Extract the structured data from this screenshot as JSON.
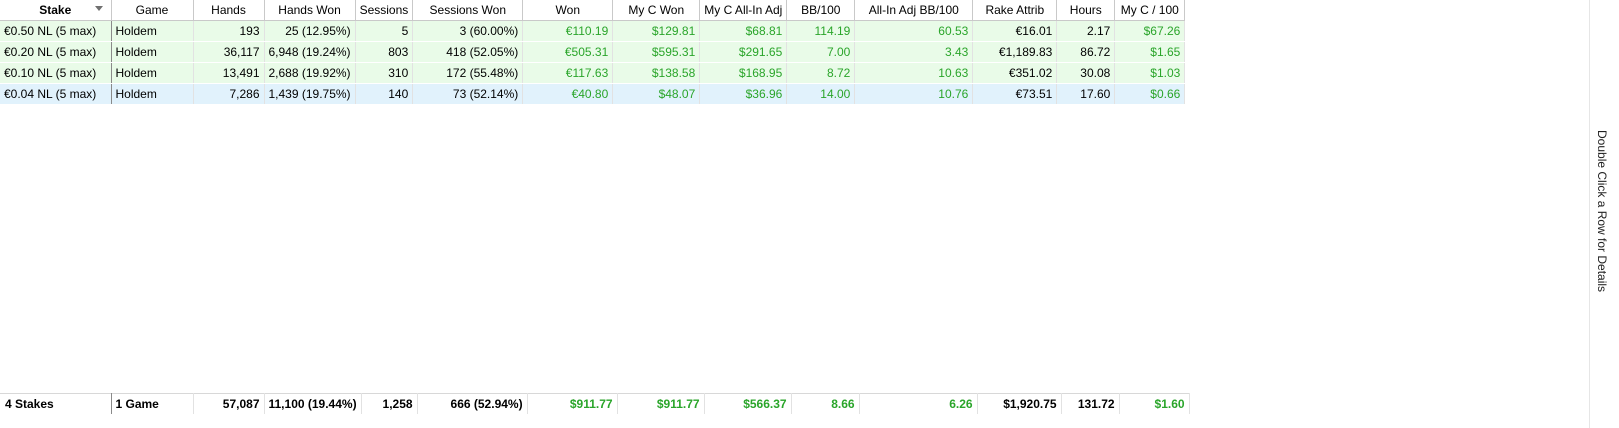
{
  "columns": [
    "Stake",
    "Game",
    "Hands",
    "Hands Won",
    "Sessions",
    "Sessions Won",
    "Won",
    "My C Won",
    "My C All-In Adj",
    "BB/100",
    "All-In Adj BB/100",
    "Rake Attrib",
    "Hours",
    "My C / 100"
  ],
  "rows": [
    {
      "stake": "€0.50 NL (5 max)",
      "game": "Holdem",
      "hands": "193",
      "hands_won": "25 (12.95%)",
      "sessions": "5",
      "sessions_won": "3 (60.00%)",
      "won": "€110.19",
      "my_c_won": "$129.81",
      "my_c_allin_adj": "$68.81",
      "bb100": "114.19",
      "allin_adj_bb100": "60.53",
      "rake_attrib": "€16.01",
      "hours": "2.17",
      "my_c_100": "$67.26",
      "highlight": "green"
    },
    {
      "stake": "€0.20 NL (5 max)",
      "game": "Holdem",
      "hands": "36,117",
      "hands_won": "6,948 (19.24%)",
      "sessions": "803",
      "sessions_won": "418 (52.05%)",
      "won": "€505.31",
      "my_c_won": "$595.31",
      "my_c_allin_adj": "$291.65",
      "bb100": "7.00",
      "allin_adj_bb100": "3.43",
      "rake_attrib": "€1,189.83",
      "hours": "86.72",
      "my_c_100": "$1.65",
      "highlight": "green"
    },
    {
      "stake": "€0.10 NL (5 max)",
      "game": "Holdem",
      "hands": "13,491",
      "hands_won": "2,688 (19.92%)",
      "sessions": "310",
      "sessions_won": "172 (55.48%)",
      "won": "€117.63",
      "my_c_won": "$138.58",
      "my_c_allin_adj": "$168.95",
      "bb100": "8.72",
      "allin_adj_bb100": "10.63",
      "rake_attrib": "€351.02",
      "hours": "30.08",
      "my_c_100": "$1.03",
      "highlight": "green"
    },
    {
      "stake": "€0.04 NL (5 max)",
      "game": "Holdem",
      "hands": "7,286",
      "hands_won": "1,439 (19.75%)",
      "sessions": "140",
      "sessions_won": "73 (52.14%)",
      "won": "€40.80",
      "my_c_won": "$48.07",
      "my_c_allin_adj": "$36.96",
      "bb100": "14.00",
      "allin_adj_bb100": "10.76",
      "rake_attrib": "€73.51",
      "hours": "17.60",
      "my_c_100": "$0.66",
      "highlight": "blue"
    }
  ],
  "totals": {
    "stake": "4 Stakes",
    "game": "1 Game",
    "hands": "57,087",
    "hands_won": "11,100 (19.44%)",
    "sessions": "1,258",
    "sessions_won": "666 (52.94%)",
    "won": "$911.77",
    "my_c_won": "$911.77",
    "my_c_allin_adj": "$566.37",
    "bb100": "8.66",
    "allin_adj_bb100": "6.26",
    "rake_attrib": "$1,920.75",
    "hours": "131.72",
    "my_c_100": "$1.60"
  },
  "side_label": "Double Click a Row for Details",
  "colors": {
    "green_text": "#2aa52a",
    "row_green": "#e9fbe8",
    "row_blue": "#e1f2fc"
  },
  "icons": {
    "sort": "chevron-down-icon"
  }
}
